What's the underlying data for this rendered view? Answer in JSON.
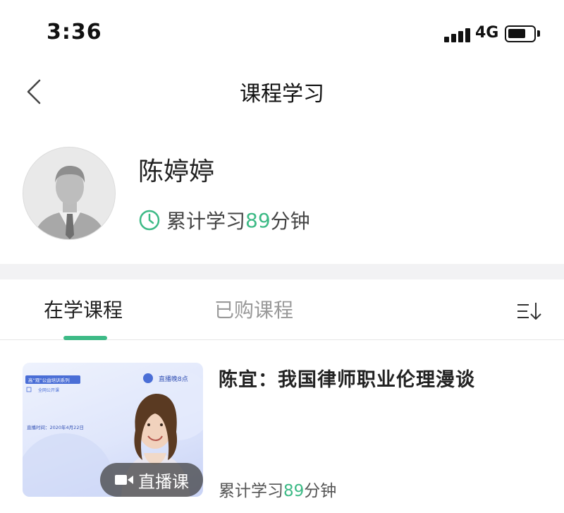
{
  "status_bar": {
    "time": "3:36",
    "network": "4G"
  },
  "nav": {
    "title": "课程学习"
  },
  "profile": {
    "name": "陈婷婷",
    "study_prefix": "累计学习",
    "study_minutes": "89",
    "study_suffix": "分钟"
  },
  "tabs": [
    {
      "label": "在学课程",
      "active": true
    },
    {
      "label": "已购课程",
      "active": false
    }
  ],
  "courses": [
    {
      "title": "陈宜：我国律师职业伦理漫谈",
      "badge": "直播课",
      "study_prefix": "累计学习",
      "study_minutes": "89",
      "study_suffix": "分钟",
      "thumbnail": {
        "series_tag": "高“观”公益培训系列",
        "sub_tag": "全网公开课",
        "date_text": "直播时间：2020年4月22日",
        "logo_text": "直播晚8点"
      }
    }
  ],
  "colors": {
    "accent": "#3dba86",
    "band": "#f2f2f4"
  },
  "icons": [
    "back-icon",
    "clock-icon",
    "sort-icon",
    "video-camera-icon",
    "signal-icon",
    "battery-icon",
    "avatar-placeholder-icon"
  ]
}
